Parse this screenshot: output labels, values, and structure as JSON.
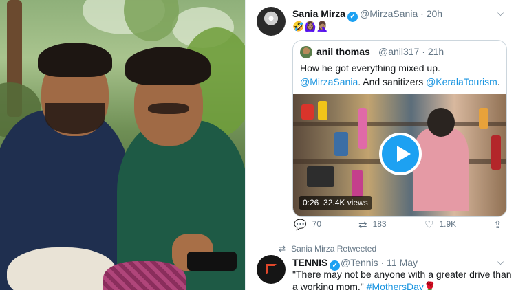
{
  "tweet1": {
    "name": "Sania Mirza",
    "handle": "@MirzaSania",
    "time": "20h",
    "emojis": "🤣🙆🏽‍♀️🤦🏽‍♀️",
    "quote": {
      "name": "anil thomas",
      "handle": "@anil317",
      "time": "21h",
      "text_plain_1": "How he got everything mixed up. ",
      "text_link_1": "@MirzaSania",
      "text_plain_2": ". And sanitizers ",
      "text_link_2": "@KeralaTourism",
      "text_plain_3": ".",
      "video_time": "0:26",
      "video_views": "32.4K views"
    },
    "actions": {
      "replies": "70",
      "retweets": "183",
      "likes": "1.9K"
    }
  },
  "retweet_label": "Sania Mirza Retweeted",
  "tweet2": {
    "name": "TENNIS",
    "handle": "@Tennis",
    "time": "11 May",
    "text_plain": "\"There may not be anyone with a greater drive than a working mom.\" ",
    "hashtag": "#MothersDay",
    "emoji": "🌹"
  },
  "icons": {
    "verified": "verified-check-icon",
    "caret": "chevron-down-icon",
    "reply": "reply-icon",
    "retweet": "retweet-icon",
    "like": "heart-icon",
    "share": "share-icon",
    "play": "play-icon"
  },
  "colors": {
    "accent": "#1da1f2",
    "link": "#1b95e0",
    "text": "#14171a",
    "muted": "#657786"
  }
}
